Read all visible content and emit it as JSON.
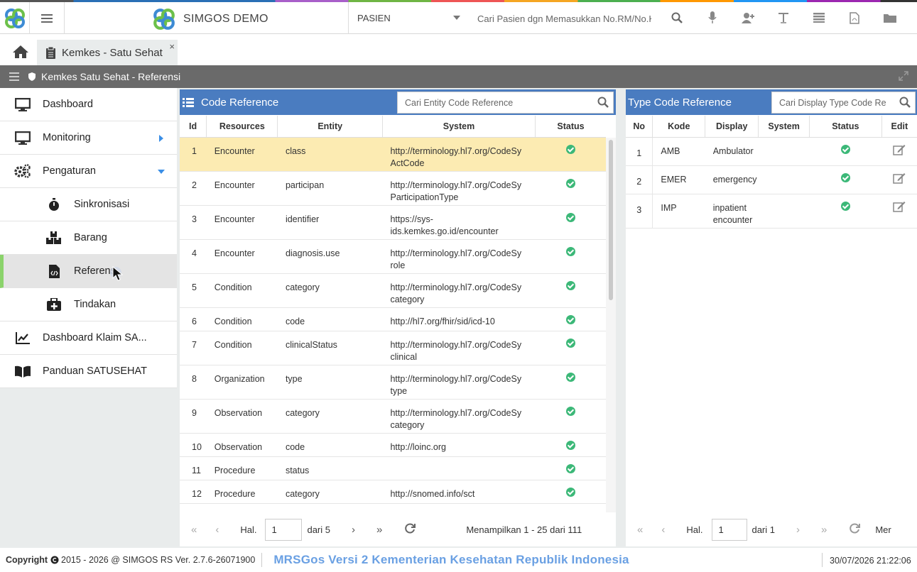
{
  "header": {
    "brand": "SIMGOS DEMO",
    "select_value": "PASIEN",
    "search_placeholder": "Cari Pasien dgn Memasukkan No.RM/No.K"
  },
  "tabs": [
    {
      "label": "Kemkes - Satu Sehat",
      "close": "×"
    }
  ],
  "breadcrumb": "Kemkes Satu Sehat - Referensi",
  "sidebar": {
    "items": [
      {
        "label": "Dashboard",
        "icon": "monitor-icon"
      },
      {
        "label": "Monitoring",
        "icon": "monitor-icon"
      },
      {
        "label": "Pengaturan",
        "icon": "cogs-icon"
      },
      {
        "label": "Sinkronisasi",
        "icon": "stopwatch-icon"
      },
      {
        "label": "Barang",
        "icon": "boxes-icon"
      },
      {
        "label": "Referensi",
        "icon": "file-code-icon"
      },
      {
        "label": "Tindakan",
        "icon": "medkit-icon"
      },
      {
        "label": "Dashboard Klaim SA...",
        "icon": "chart-line-icon"
      },
      {
        "label": "Panduan SATUSEHAT",
        "icon": "book-icon"
      }
    ]
  },
  "code_ref": {
    "title": "Code Reference",
    "search_placeholder": "Cari Entity Code Reference",
    "columns": [
      "Id",
      "Resources",
      "Entity",
      "System",
      "Status"
    ],
    "rows": [
      {
        "id": "1",
        "resource": "Encounter",
        "entity": "class",
        "system": "http://terminology.hl7.org/CodeSy ActCode"
      },
      {
        "id": "2",
        "resource": "Encounter",
        "entity": "participan",
        "system": "http://terminology.hl7.org/CodeSy ParticipationType"
      },
      {
        "id": "3",
        "resource": "Encounter",
        "entity": "identifier",
        "system": "https://sys- ids.kemkes.go.id/encounter"
      },
      {
        "id": "4",
        "resource": "Encounter",
        "entity": "diagnosis.use",
        "system": "http://terminology.hl7.org/CodeSy role"
      },
      {
        "id": "5",
        "resource": "Condition",
        "entity": "category",
        "system": "http://terminology.hl7.org/CodeSy category"
      },
      {
        "id": "6",
        "resource": "Condition",
        "entity": "code",
        "system": "http://hl7.org/fhir/sid/icd-10"
      },
      {
        "id": "7",
        "resource": "Condition",
        "entity": "clinicalStatus",
        "system": "http://terminology.hl7.org/CodeSy clinical"
      },
      {
        "id": "8",
        "resource": "Organization",
        "entity": "type",
        "system": "http://terminology.hl7.org/CodeSy type"
      },
      {
        "id": "9",
        "resource": "Observation",
        "entity": "category",
        "system": "http://terminology.hl7.org/CodeSy category"
      },
      {
        "id": "10",
        "resource": "Observation",
        "entity": "code",
        "system": "http://loinc.org"
      },
      {
        "id": "11",
        "resource": "Procedure",
        "entity": "status",
        "system": ""
      },
      {
        "id": "12",
        "resource": "Procedure",
        "entity": "category",
        "system": "http://snomed.info/sct"
      }
    ],
    "pager": {
      "hal": "Hal.",
      "page": "1",
      "dari": "dari 5",
      "info": "Menampilkan 1 - 25 dari 111"
    }
  },
  "type_ref": {
    "title": "Type Code Reference",
    "search_placeholder": "Cari Display Type Code Re",
    "columns": [
      "No",
      "Kode",
      "Display",
      "System",
      "Status",
      "Edit"
    ],
    "rows": [
      {
        "no": "1",
        "kode": "AMB",
        "display": "Ambulator"
      },
      {
        "no": "2",
        "kode": "EMER",
        "display": "emergency"
      },
      {
        "no": "3",
        "kode": "IMP",
        "display": "inpatient encounter"
      }
    ],
    "pager": {
      "hal": "Hal.",
      "page": "1",
      "dari": "dari 1",
      "info": "Mer"
    }
  },
  "footer": {
    "copyright_bold": "Copyright",
    "copyright": "2015 - 2026 @ SIMGOS RS Ver. 2.7.6-26071900",
    "banner": "MRSGos Versi 2 Kementerian Kesehatan Republik Indonesia",
    "datetime": "30/07/2026 21:22:06"
  },
  "colors": {
    "accent": "#4a7cc0",
    "status_ok": "#3cb878",
    "highlight_row": "#fcebb2",
    "active_bar": "#8bd36b"
  }
}
